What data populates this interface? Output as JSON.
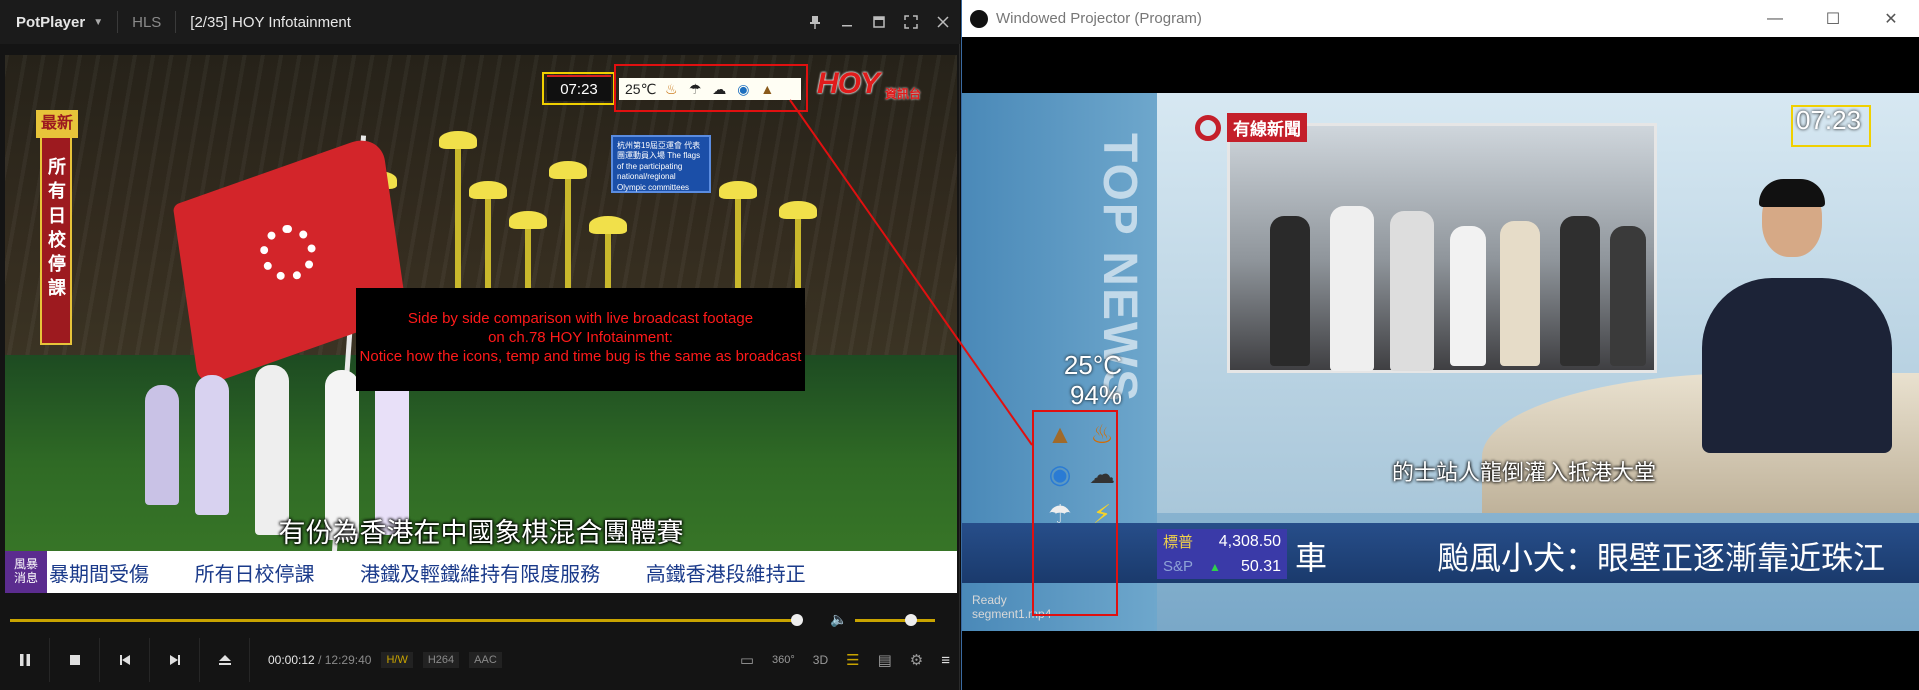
{
  "potplayer": {
    "app_name": "PotPlayer",
    "source": "HLS",
    "title": "[2/35] HOY Infotainment",
    "video": {
      "side_banner_top": "最新",
      "side_banner_text": "所有日校停課",
      "sign_text": "杭州第19屆亞運會 代表團運動員入場 The flags of the participating national/regional Olympic committees",
      "time_bug": "07:23",
      "weather_temp": "25℃",
      "channel_logo": "HOY",
      "channel_sub": "資訊台",
      "note_line1": "Side by side comparison with live broadcast footage",
      "note_line2": "on ch.78 HOY Infotainment:",
      "note_line3": "Notice how the icons, temp and time bug is the same as broadcast",
      "subtitle": "有份為香港在中國象棋混合團體賽",
      "ticker_badge_1": "風暴",
      "ticker_badge_2": "消息",
      "ticker_items": [
        "暴期間受傷",
        "所有日校停課",
        "港鐵及輕鐵維持有限度服務",
        "高鐵香港段維持正"
      ]
    },
    "controls": {
      "current_time": "00:00:12",
      "separator": "/",
      "duration": "12:29:40",
      "hw": "H/W",
      "video_codec": "H264",
      "audio_codec": "AAC",
      "vr_label": "360°",
      "threed_label": "3D"
    }
  },
  "projector": {
    "title": "Windowed Projector (Program)",
    "video": {
      "channel_logo": "有線新聞",
      "side_text": "TOP NEWS",
      "time_bug": "07:23",
      "weather_temp": "25°C",
      "weather_humidity": "94%",
      "subtitle": "的士站人龍倒灌入抵港大堂",
      "stock_label_1": "標普",
      "stock_value_1": "4,308.50",
      "stock_label_2": "S&P",
      "stock_value_2": "50.31",
      "ticker_tail": "車",
      "ticker_headline": "颱風小犬：眼壁正逐漸靠近珠江"
    },
    "status_line1": "Ready",
    "status_line2": "segment1.mp4"
  },
  "colors": {
    "annotation_red": "#e01010",
    "annotation_yellow": "#f0d000",
    "player_accent": "#c9a400"
  }
}
